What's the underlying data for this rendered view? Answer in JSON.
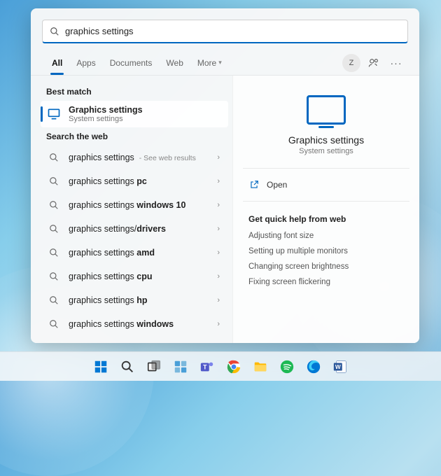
{
  "search": {
    "query": "graphics settings"
  },
  "filters": {
    "tabs": [
      "All",
      "Apps",
      "Documents",
      "Web",
      "More"
    ],
    "active_index": 0,
    "avatar_letter": "Z"
  },
  "sections": {
    "best_match": "Best match",
    "web": "Search the web"
  },
  "best_match": {
    "title": "Graphics settings",
    "subtitle": "System settings"
  },
  "web_results": [
    {
      "prefix": "graphics settings",
      "suffix": "",
      "hint": " - See web results"
    },
    {
      "prefix": "graphics settings ",
      "suffix": "pc",
      "hint": ""
    },
    {
      "prefix": "graphics settings ",
      "suffix": "windows 10",
      "hint": ""
    },
    {
      "prefix": "graphics settings/",
      "suffix": "drivers",
      "hint": ""
    },
    {
      "prefix": "graphics settings ",
      "suffix": "amd",
      "hint": ""
    },
    {
      "prefix": "graphics settings ",
      "suffix": "cpu",
      "hint": ""
    },
    {
      "prefix": "graphics settings ",
      "suffix": "hp",
      "hint": ""
    },
    {
      "prefix": "graphics settings ",
      "suffix": "windows",
      "hint": ""
    }
  ],
  "preview": {
    "title": "Graphics settings",
    "subtitle": "System settings",
    "open_label": "Open",
    "quick_help_header": "Get quick help from web",
    "quick_links": [
      "Adjusting font size",
      "Setting up multiple monitors",
      "Changing screen brightness",
      "Fixing screen flickering"
    ]
  },
  "taskbar": {
    "icons": [
      "start",
      "search",
      "taskview",
      "widgets",
      "teams",
      "chrome",
      "explorer",
      "spotify",
      "edge",
      "word"
    ]
  }
}
